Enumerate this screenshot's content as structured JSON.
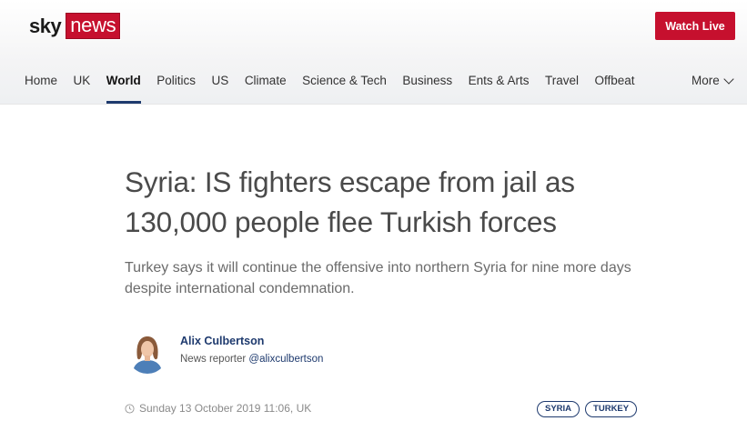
{
  "brand": {
    "logo_part1": "sky",
    "logo_part2": "news",
    "accent": "#c6102e",
    "link_color": "#1e3a6e"
  },
  "header": {
    "watch_live_label": "Watch Live"
  },
  "nav": {
    "items": [
      {
        "label": "Home"
      },
      {
        "label": "UK"
      },
      {
        "label": "World",
        "active": true
      },
      {
        "label": "Politics"
      },
      {
        "label": "US"
      },
      {
        "label": "Climate"
      },
      {
        "label": "Science & Tech"
      },
      {
        "label": "Business"
      },
      {
        "label": "Ents & Arts"
      },
      {
        "label": "Travel"
      },
      {
        "label": "Offbeat"
      }
    ],
    "more_label": "More"
  },
  "article": {
    "headline": "Syria: IS fighters escape from jail as 130,000 people flee Turkish forces",
    "standfirst": "Turkey says it will continue the offensive into northern Syria for nine more days despite international condemnation.",
    "author": {
      "name": "Alix Culbertson",
      "role": "News reporter",
      "handle": "@alixculbertson"
    },
    "timestamp": "Sunday 13 October 2019 11:06, UK",
    "tags": [
      "SYRIA",
      "TURKEY"
    ]
  }
}
